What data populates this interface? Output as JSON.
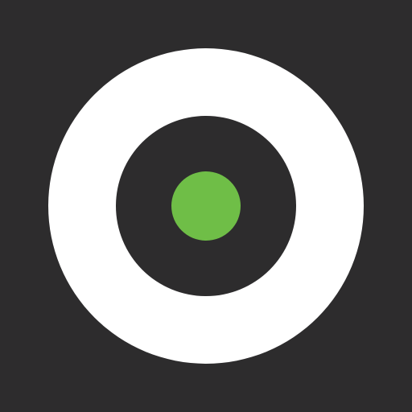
{
  "icon": {
    "name": "target-record-icon",
    "colors": {
      "background": "#2d2c2d",
      "outer_ring": "#ffffff",
      "inner_disc": "#2d2c2d",
      "center_dot": "#6fbe47"
    }
  }
}
